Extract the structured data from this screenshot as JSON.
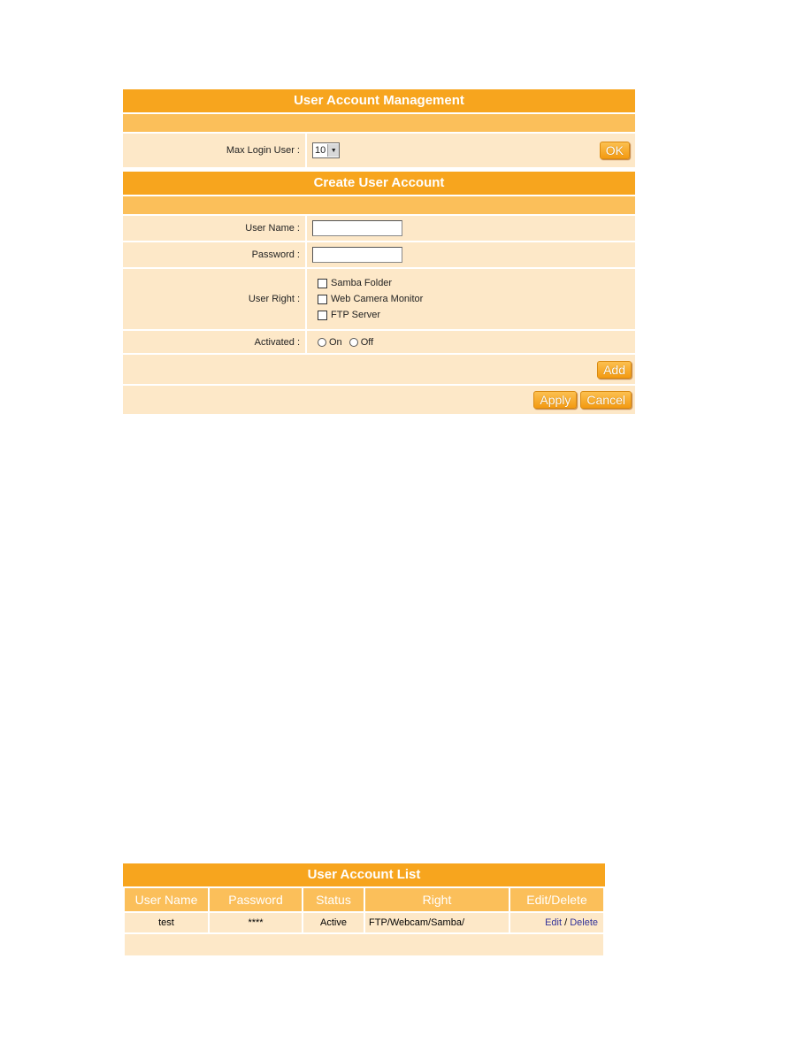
{
  "uam": {
    "title": "User Account Management",
    "max_login_label": "Max Login User :",
    "max_login_value": "10",
    "ok_label": "OK"
  },
  "create": {
    "title": "Create User Account",
    "username_label": "User Name :",
    "username_value": "",
    "password_label": "Password :",
    "password_value": "",
    "user_right_label": "User Right :",
    "rights": [
      {
        "label": "Samba Folder",
        "checked": false
      },
      {
        "label": "Web Camera Monitor",
        "checked": false
      },
      {
        "label": "FTP Server",
        "checked": false
      }
    ],
    "activated_label": "Activated :",
    "on_label": "On",
    "off_label": "Off",
    "add_label": "Add",
    "apply_label": "Apply",
    "cancel_label": "Cancel"
  },
  "list": {
    "title": "User Account List",
    "columns": [
      "User Name",
      "Password",
      "Status",
      "Right",
      "Edit/Delete"
    ],
    "rows": [
      {
        "user": "test",
        "password": "****",
        "status": "Active",
        "right": "FTP/Webcam/Samba/",
        "edit": "Edit",
        "sep": " / ",
        "delete": "Delete"
      }
    ]
  }
}
